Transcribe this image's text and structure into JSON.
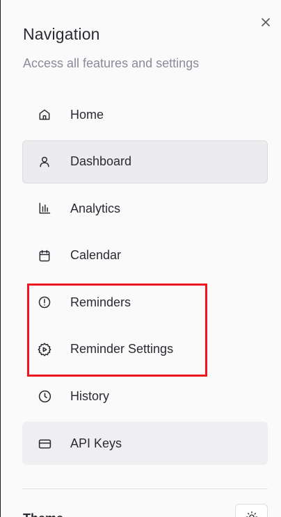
{
  "header": {
    "title": "Navigation",
    "subtitle": "Access all features and settings"
  },
  "nav": {
    "items": [
      {
        "label": "Home",
        "icon": "home-icon"
      },
      {
        "label": "Dashboard",
        "icon": "user-icon",
        "active": true
      },
      {
        "label": "Analytics",
        "icon": "bar-chart-icon"
      },
      {
        "label": "Calendar",
        "icon": "calendar-icon"
      },
      {
        "label": "Reminders",
        "icon": "alert-circle-icon"
      },
      {
        "label": "Reminder Settings",
        "icon": "settings-play-icon"
      },
      {
        "label": "History",
        "icon": "clock-icon"
      },
      {
        "label": "API Keys",
        "icon": "credit-card-icon"
      }
    ]
  },
  "footer": {
    "theme_label": "Theme",
    "theme_icon": "sun-icon"
  },
  "colors": {
    "highlight": "#f0141e",
    "text": "#2a2a33",
    "muted": "#8a8a9a",
    "active_bg": "#ececef"
  }
}
